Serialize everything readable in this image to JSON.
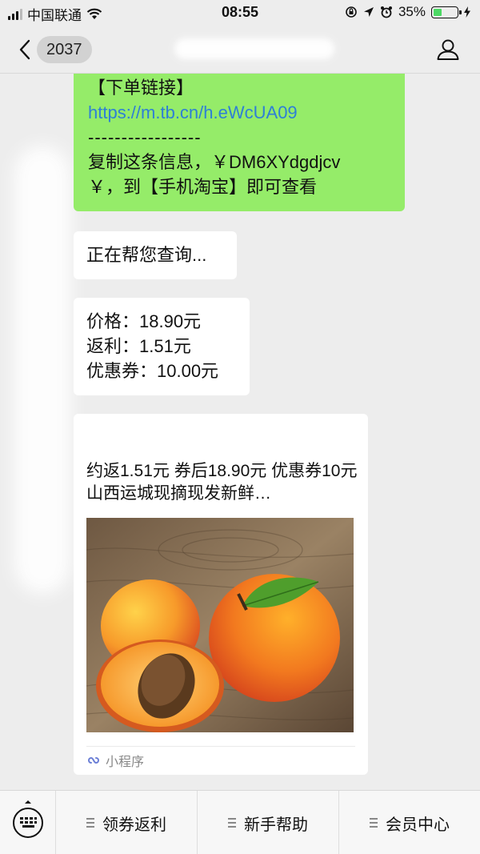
{
  "status_bar": {
    "carrier": "中国联通",
    "time": "08:55",
    "battery": "35%",
    "battery_level": 0.35
  },
  "nav": {
    "back_count": "2037"
  },
  "messages": {
    "link_msg": {
      "line1": "【下单链接】",
      "link": "https://m.tb.cn/h.eWcUA09",
      "dashes": "-----------------",
      "line3": "复制这条信息，￥DM6XYdgdjcv",
      "line4": "￥，到【手机淘宝】即可查看"
    },
    "querying": "正在帮您查询...",
    "price": {
      "line1": "价格：18.90元",
      "line2": "返利：1.51元",
      "line3": "优惠券：10.00元"
    },
    "card": {
      "title": "约返1.51元 券后18.90元 优惠券10元 山西运城现摘现发新鲜…",
      "footer_label": "小程序"
    }
  },
  "bottom_menu": {
    "items": [
      "领券返利",
      "新手帮助",
      "会员中心"
    ]
  }
}
